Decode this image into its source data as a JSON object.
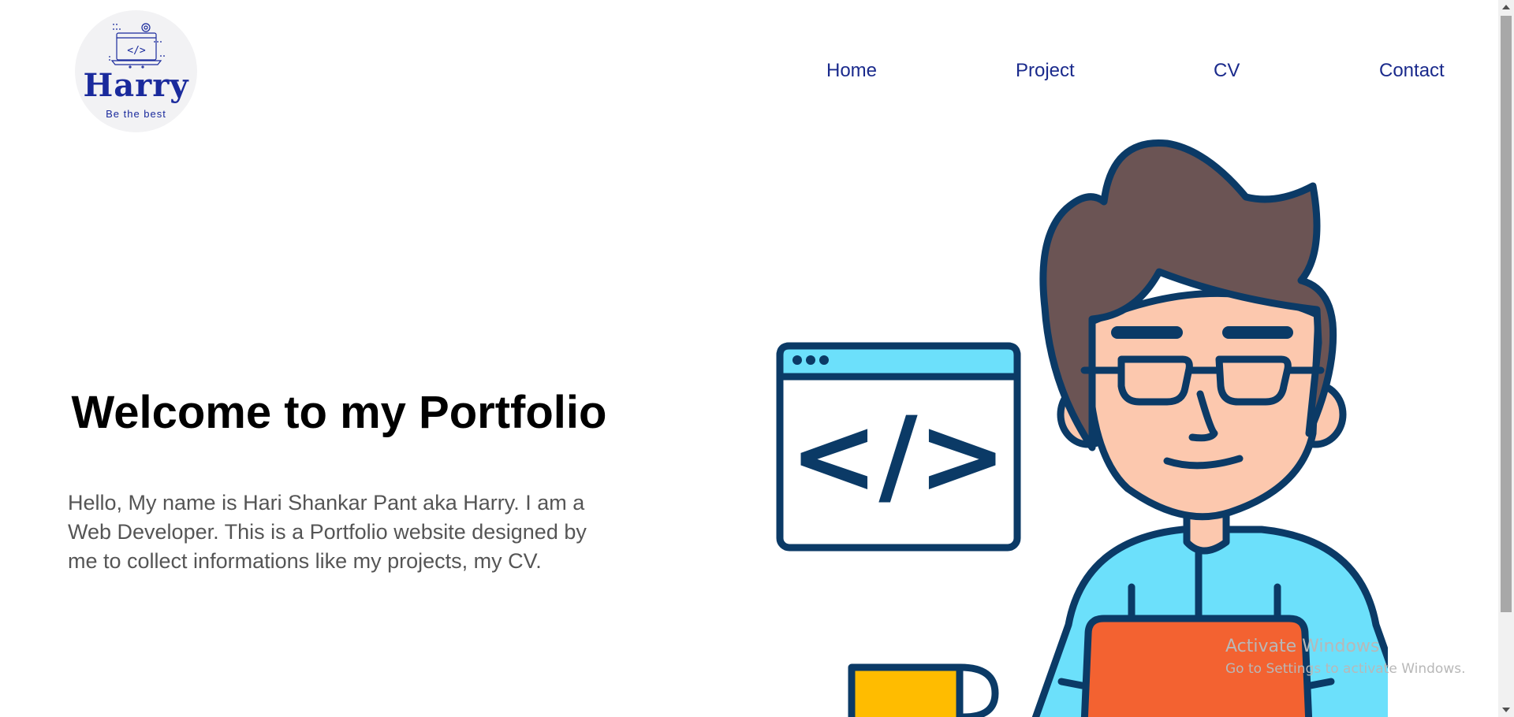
{
  "logo": {
    "name": "Harry",
    "tagline": "Be the best",
    "icon": "laptop-code-icon",
    "code_glyph": "</>"
  },
  "nav": {
    "items": [
      {
        "label": "Home"
      },
      {
        "label": "Project"
      },
      {
        "label": "CV"
      },
      {
        "label": "Contact"
      }
    ]
  },
  "hero": {
    "title": "Welcome to my Portfolio",
    "text": "Hello, My name is Hari Shankar Pant aka Harry. I am a Web Developer. This is a Portfolio website designed by me to collect informations like my projects, my CV."
  },
  "illustration": {
    "icon": "developer-illustration",
    "code_glyph": "</>"
  },
  "watermark": {
    "title": "Activate Windows",
    "subtitle": "Go to Settings to activate Windows."
  },
  "colors": {
    "nav_link": "#1a2a8c",
    "logo_text": "#1a2a9c",
    "outline": "#0b3a66",
    "hair": "#6b5454",
    "skin": "#fcc8ae",
    "shirt": "#6ce0fb",
    "laptop": "#f36231",
    "mug": "#ffbc00"
  }
}
